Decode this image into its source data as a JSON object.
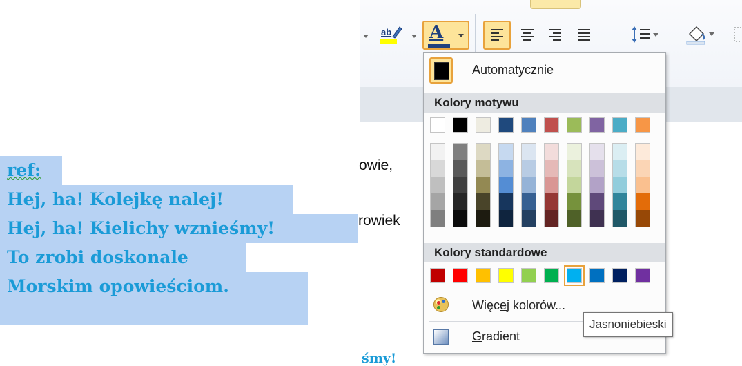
{
  "document": {
    "lines": [
      "ref:",
      "Hej, ha! Kolejkę nalej!",
      "Hej, ha! Kielichy wznieśmy!",
      "To zrobi doskonale",
      "Morskim opowieściom."
    ],
    "fragments": [
      "owie,",
      "rowiek",
      "śmy!"
    ]
  },
  "ribbon": {
    "highlight_icon": "highlighter-icon",
    "font_color_letter": "A",
    "font_color_current": "#1f3f7e"
  },
  "panel": {
    "automatic_label_prefix": "A",
    "automatic_label_rest": "utomatycznie",
    "automatic_color": "#000000",
    "theme_header": "Kolory motywu",
    "theme_colors": [
      "#ffffff",
      "#000000",
      "#eeece1",
      "#1f497d",
      "#4f81bd",
      "#c0504d",
      "#9bbb59",
      "#8064a2",
      "#4bacc6",
      "#f79646"
    ],
    "theme_shades": [
      [
        "#f2f2f2",
        "#d8d8d8",
        "#bfbfbf",
        "#a5a5a5",
        "#7f7f7f"
      ],
      [
        "#7f7f7f",
        "#595959",
        "#3f3f3f",
        "#262626",
        "#0c0c0c"
      ],
      [
        "#ddd9c3",
        "#c4bd97",
        "#938953",
        "#494429",
        "#1d1b10"
      ],
      [
        "#c6d9f0",
        "#8db3e2",
        "#548dd4",
        "#17365d",
        "#0f243e"
      ],
      [
        "#dbe5f1",
        "#b8cce4",
        "#95b3d7",
        "#366092",
        "#244061"
      ],
      [
        "#f2dcdb",
        "#e5b9b7",
        "#d99694",
        "#953734",
        "#632423"
      ],
      [
        "#ebf1dd",
        "#d7e3bc",
        "#c3d69b",
        "#76923c",
        "#4f6128"
      ],
      [
        "#e5e0ec",
        "#ccc1d9",
        "#b2a2c7",
        "#5f497a",
        "#3f3151"
      ],
      [
        "#dbeef3",
        "#b7dde8",
        "#92cddc",
        "#31859b",
        "#205867"
      ],
      [
        "#fdeada",
        "#fbd5b5",
        "#fac08f",
        "#e36c09",
        "#974806"
      ]
    ],
    "standard_header": "Kolory standardowe",
    "standard_colors": [
      "#c00000",
      "#ff0000",
      "#ffc000",
      "#ffff00",
      "#92d050",
      "#00b050",
      "#00b0f0",
      "#0070c0",
      "#002060",
      "#7030a0"
    ],
    "standard_selected_index": 6,
    "more_colors_a": "Więc",
    "more_colors_u": "e",
    "more_colors_b": "j kolorów...",
    "gradient_prefix": "G",
    "gradient_rest": "radient"
  },
  "tooltip": {
    "text": "Jasnoniebieski"
  }
}
